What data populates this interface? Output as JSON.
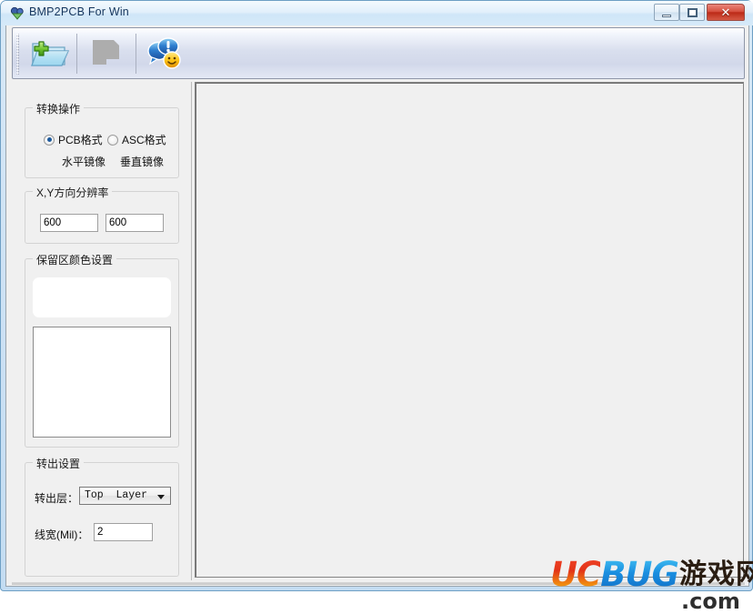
{
  "window": {
    "title": "BMP2PCB For Win",
    "icon": "app-icon",
    "controls": {
      "minimize": "–",
      "maximize": "❐",
      "close": "✕"
    }
  },
  "toolbar": {
    "buttons": [
      {
        "name": "open-file-button",
        "icon": "folder-add-icon",
        "label": ""
      },
      {
        "name": "save-file-button",
        "icon": "save-disabled-icon",
        "label": ""
      },
      {
        "name": "about-button",
        "icon": "about-smiley-icon",
        "label": ""
      }
    ]
  },
  "sidebar": {
    "convert_group": {
      "title": "转换操作",
      "radios": [
        {
          "label": "PCB格式",
          "selected": true
        },
        {
          "label": "ASC格式",
          "selected": false
        }
      ],
      "mirror_options": [
        {
          "label": "水平镜像"
        },
        {
          "label": "垂直镜像"
        }
      ]
    },
    "resolution_group": {
      "title": "X,Y方向分辨率",
      "x_value": "600",
      "y_value": "600"
    },
    "color_group": {
      "title": "保留区颜色设置",
      "preview_color": "#ffffff",
      "list_items": []
    },
    "export_group": {
      "title": "转出设置",
      "layer_label": "转出层：",
      "layer_value": "Top  Layer",
      "width_label": "线宽(Mil)：",
      "width_value": "2"
    }
  },
  "canvas": {
    "content": ""
  },
  "watermark": {
    "uc": "UC",
    "bug": "BUG",
    "cn": "游戏网",
    "com": ".com"
  }
}
